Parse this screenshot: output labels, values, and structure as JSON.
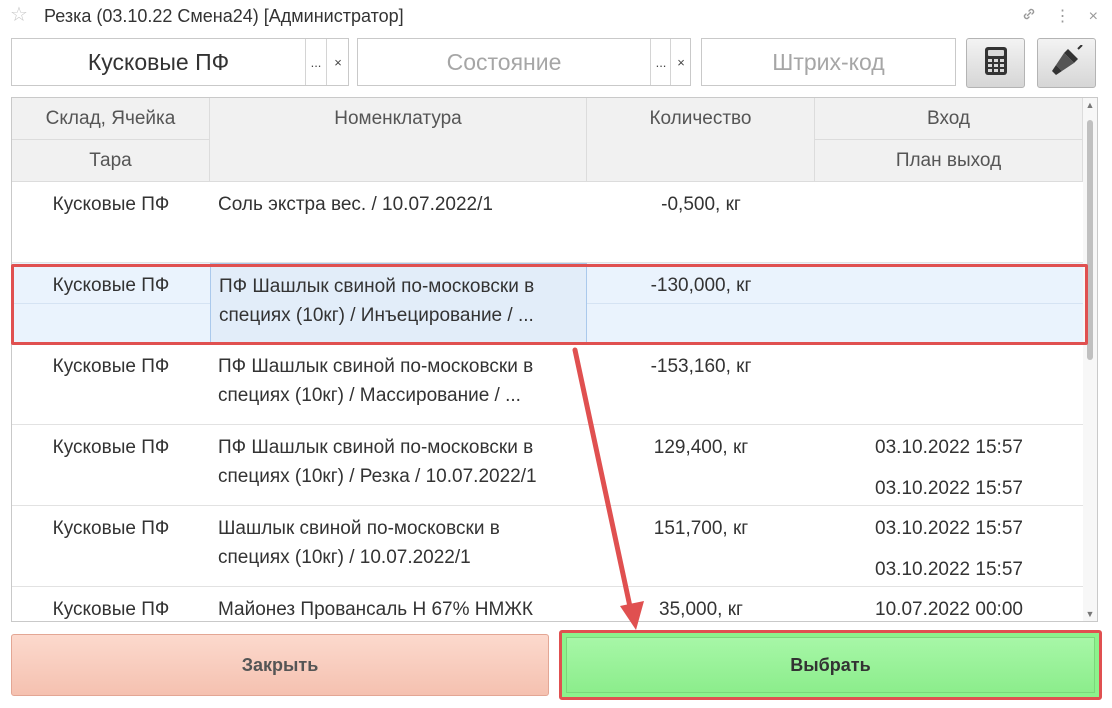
{
  "window": {
    "title": "Резка (03.10.22 Смена24) [Администратор]"
  },
  "filters": {
    "warehouse_value": "Кусковые ПФ",
    "state_placeholder": "Состояние",
    "barcode_placeholder": "Штрих-код",
    "select_glyph": "...",
    "clear_glyph": "×"
  },
  "table": {
    "columns": {
      "sklad": "Склад, Ячейка",
      "tara": "Тара",
      "nomenclature": "Номенклатура",
      "quantity": "Количество",
      "vhod": "Вход",
      "plan": "План выход"
    },
    "rows": [
      {
        "sklad": "Кусковые ПФ",
        "nom1": "Соль экстра вес. / 10.07.2022/1",
        "nom2": "",
        "qty": "-0,500, кг",
        "vhod": "",
        "plan": ""
      },
      {
        "sklad": "Кусковые ПФ",
        "nom1": "ПФ Шашлык свиной по-московски в",
        "nom2": "специях (10кг) / Инъецирование / ...",
        "qty": "-130,000, кг",
        "vhod": "",
        "plan": ""
      },
      {
        "sklad": "Кусковые ПФ",
        "nom1": "ПФ Шашлык свиной по-московски в",
        "nom2": "специях (10кг) / Массирование / ...",
        "qty": "-153,160, кг",
        "vhod": "",
        "plan": ""
      },
      {
        "sklad": "Кусковые ПФ",
        "nom1": "ПФ Шашлык свиной по-московски в",
        "nom2": "специях (10кг) / Резка / 10.07.2022/1",
        "qty": "129,400, кг",
        "vhod": "03.10.2022 15:57",
        "plan": "03.10.2022 15:57"
      },
      {
        "sklad": "Кусковые ПФ",
        "nom1": "Шашлык свиной по-московски в",
        "nom2": "специях (10кг) / 10.07.2022/1",
        "qty": "151,700, кг",
        "vhod": "03.10.2022 15:57",
        "plan": "03.10.2022 15:57"
      },
      {
        "sklad": "Кусковые ПФ",
        "nom1": "Майонез Провансаль Н 67% НМЖК",
        "nom2": "",
        "qty": "35,000, кг",
        "vhod": "10.07.2022 00:00",
        "plan": ""
      }
    ],
    "selected_row": 1
  },
  "buttons": {
    "close_label": "Закрыть",
    "select_label": "Выбрать"
  },
  "icons": {
    "favorite": "star-icon",
    "link": "link-icon",
    "more": "more-vertical-icon",
    "close": "close-icon",
    "calculator": "calculator-icon",
    "scanner": "barcode-scanner-icon"
  },
  "colors": {
    "highlight": "#e05050",
    "selected_row": "#eaf3fd",
    "close_button": "#f5c1b0",
    "select_button": "#8cf28c"
  }
}
